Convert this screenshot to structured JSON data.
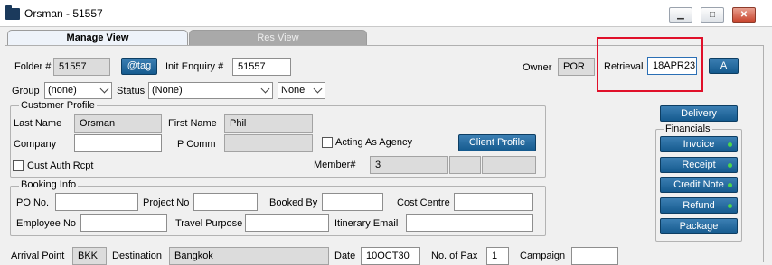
{
  "window": {
    "title": "Orsman - 51557",
    "min": "▁",
    "max": "□",
    "close": "✕"
  },
  "tabs": [
    {
      "label": "Manage View"
    },
    {
      "label": "Res View"
    }
  ],
  "top": {
    "folder_label": "Folder #",
    "folder_value": "51557",
    "tag_button": "@tag",
    "init_enquiry_label": "Init Enquiry #",
    "init_enquiry_value": "51557",
    "owner_label": "Owner",
    "owner_value": "POR",
    "retrieval_label": "Retrieval",
    "retrieval_value": "18APR23",
    "a_button": "A",
    "group_label": "Group",
    "group_value": "(none)",
    "status_label": "Status",
    "status_value": "(None)",
    "status2_value": "None"
  },
  "customer": {
    "legend": "Customer Profile",
    "last_name_label": "Last Name",
    "last_name_value": "Orsman",
    "first_name_label": "First Name",
    "first_name_value": "Phil",
    "company_label": "Company",
    "company_value": "",
    "pcomm_label": "P Comm",
    "pcomm_value": "",
    "acting_agency_label": "Acting As Agency",
    "client_profile_button": "Client Profile",
    "cust_auth_label": "Cust Auth Rcpt",
    "member_label": "Member#",
    "member_value": "3"
  },
  "booking": {
    "legend": "Booking Info",
    "po_label": "PO No.",
    "project_label": "Project No",
    "booked_by_label": "Booked By",
    "cost_centre_label": "Cost Centre",
    "employee_label": "Employee No",
    "travel_purpose_label": "Travel Purpose",
    "itinerary_email_label": "Itinerary Email"
  },
  "right": {
    "delivery": "Delivery",
    "financials_legend": "Financials",
    "invoice": "Invoice",
    "receipt": "Receipt",
    "credit_note": "Credit Note",
    "refund": "Refund",
    "package": "Package"
  },
  "bottom": {
    "arrival_label": "Arrival Point",
    "arrival_value": "BKK",
    "destination_label": "Destination",
    "destination_value": "Bangkok",
    "date_label": "Date",
    "date_value": "10OCT30",
    "pax_label": "No. of Pax",
    "pax_value": "1",
    "campaign_label": "Campaign"
  },
  "colors": {
    "button_blue": "#155a8e",
    "highlight": "#e0102a",
    "status_dot": "#4cd64c"
  }
}
